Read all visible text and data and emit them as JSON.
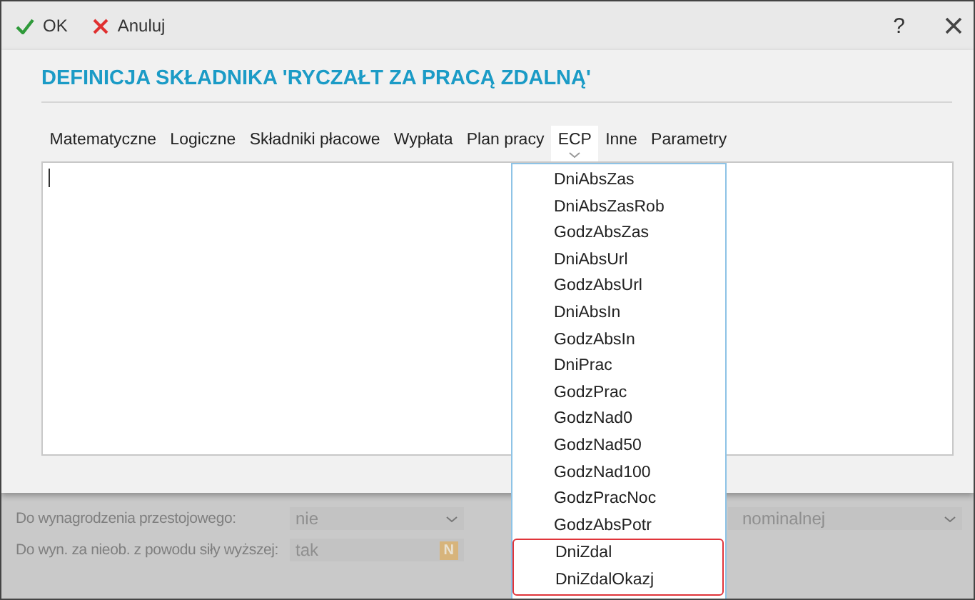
{
  "toolbar": {
    "buttons": [
      {
        "label": "OK",
        "kind": "ok"
      },
      {
        "label": "Anuluj",
        "kind": "cancel"
      }
    ],
    "help": "?"
  },
  "title": "DEFINICJA SKŁADNIKA 'RYCZAŁT ZA PRACĄ ZDALNĄ'",
  "tabs": [
    {
      "label": "Matematyczne",
      "selected": false
    },
    {
      "label": "Logiczne",
      "selected": false
    },
    {
      "label": "Składniki płacowe",
      "selected": false
    },
    {
      "label": "Wypłata",
      "selected": false
    },
    {
      "label": "Plan pracy",
      "selected": false
    },
    {
      "label": "ECP",
      "selected": true
    },
    {
      "label": "Inne",
      "selected": false
    },
    {
      "label": "Parametry",
      "selected": false
    }
  ],
  "dropdown": {
    "items": [
      {
        "label": "DniAbsZas",
        "highlighted": false
      },
      {
        "label": "DniAbsZasRob",
        "highlighted": false
      },
      {
        "label": "GodzAbsZas",
        "highlighted": false
      },
      {
        "label": "DniAbsUrl",
        "highlighted": false
      },
      {
        "label": "GodzAbsUrl",
        "highlighted": false
      },
      {
        "label": "DniAbsIn",
        "highlighted": false
      },
      {
        "label": "GodzAbsIn",
        "highlighted": false
      },
      {
        "label": "DniPrac",
        "highlighted": false
      },
      {
        "label": "GodzPrac",
        "highlighted": false
      },
      {
        "label": "GodzNad0",
        "highlighted": false
      },
      {
        "label": "GodzNad50",
        "highlighted": false
      },
      {
        "label": "GodzNad100",
        "highlighted": false
      },
      {
        "label": "GodzPracNoc",
        "highlighted": false
      },
      {
        "label": "GodzAbsPotr",
        "highlighted": false
      },
      {
        "label": "DniZdal",
        "highlighted": true
      },
      {
        "label": "DniZdalOkazj",
        "highlighted": true
      }
    ]
  },
  "background_form": {
    "rows": [
      {
        "label": "Do wynagrodzenia przestojowego:",
        "value": "nie",
        "kind": "select"
      },
      {
        "label": "Do wyn. za nieob. z powodu siły wyższej:",
        "value": "tak",
        "kind": "flag",
        "badge": "N"
      }
    ],
    "right_select": {
      "value": "nominalnej"
    }
  }
}
